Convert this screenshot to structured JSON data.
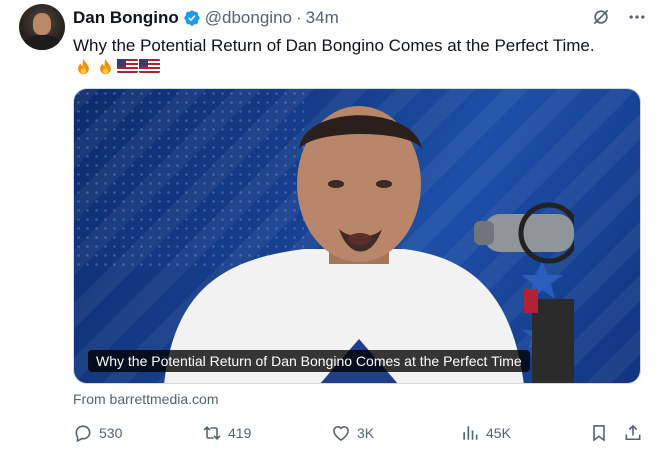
{
  "author": {
    "name": "Dan Bongino",
    "handle": "@dbongino",
    "separator": "·",
    "time": "34m"
  },
  "tweet": {
    "text": "Why the Potential Return of Dan Bongino Comes at the Perfect Time.",
    "emojis": [
      "fire",
      "fire",
      "us-flag",
      "us-flag"
    ]
  },
  "media": {
    "caption": "Why the Potential Return of Dan Bongino Comes at the Perfect Time"
  },
  "source": "From barrettmedia.com",
  "actions": {
    "replies": "530",
    "reposts": "419",
    "likes": "3K",
    "views": "45K"
  },
  "colors": {
    "text": "#0f1419",
    "secondary": "#536471",
    "verified": "#1d9bf0"
  },
  "icons": [
    "verified-badge-icon",
    "grok-icon",
    "more-icon",
    "reply-icon",
    "repost-icon",
    "like-icon",
    "views-icon",
    "bookmark-icon",
    "share-icon"
  ]
}
